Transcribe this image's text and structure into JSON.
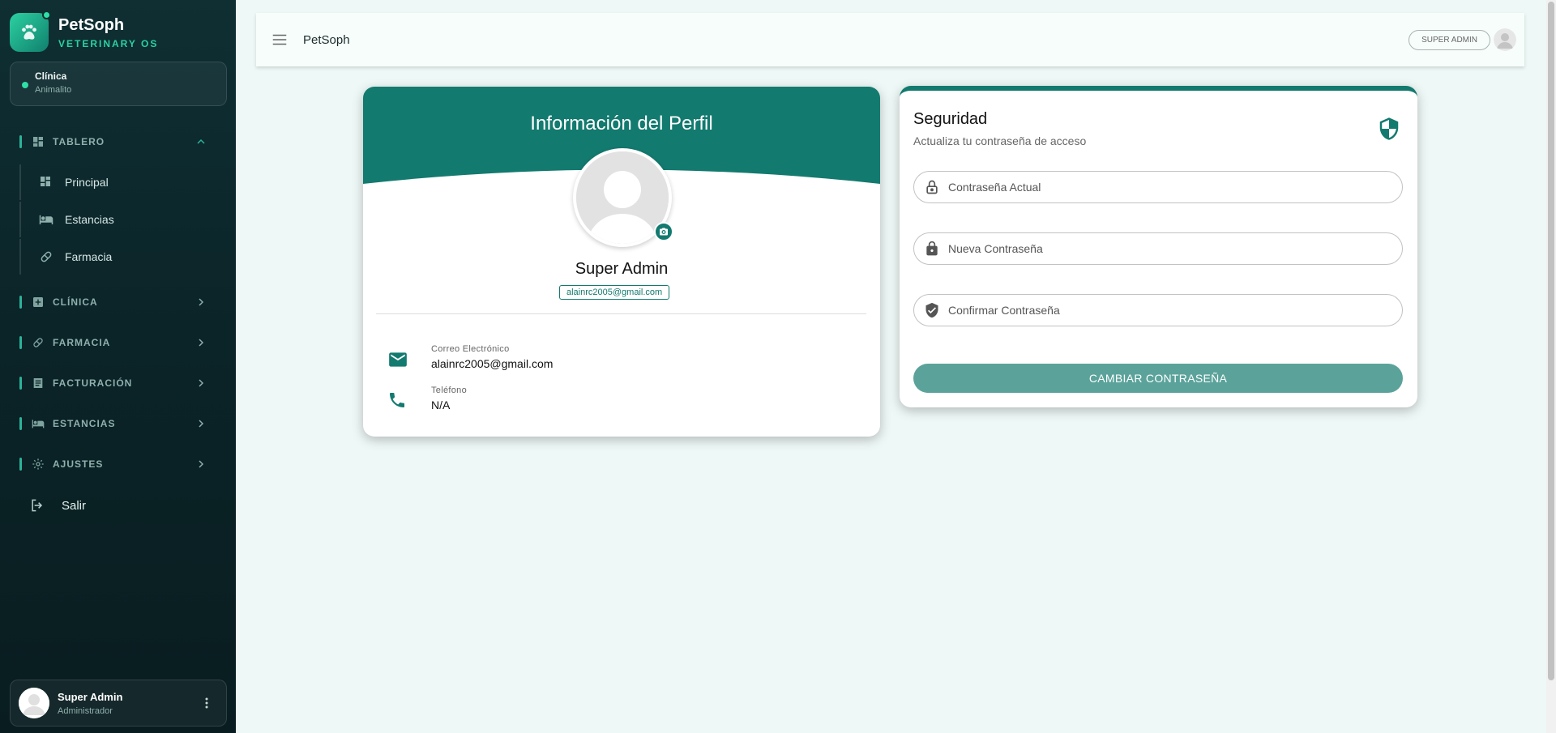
{
  "sidebar": {
    "brand_name": "PetSoph",
    "brand_sub": "VETERINARY OS",
    "clinic_label": "Clínica",
    "clinic_name": "Animalito",
    "sections": [
      {
        "label": "TABLERO",
        "icon": "dashboard-icon",
        "expanded": true
      },
      {
        "label": "CLÍNICA",
        "icon": "medical-plus-icon",
        "expanded": false
      },
      {
        "label": "FARMACIA",
        "icon": "pill-icon",
        "expanded": false
      },
      {
        "label": "FACTURACIÓN",
        "icon": "receipt-icon",
        "expanded": false
      },
      {
        "label": "ESTANCIAS",
        "icon": "bed-icon",
        "expanded": false
      },
      {
        "label": "AJUSTES",
        "icon": "gear-icon",
        "expanded": false
      }
    ],
    "tablero_items": [
      {
        "label": "Principal",
        "icon": "dashboard-icon"
      },
      {
        "label": "Estancias",
        "icon": "bed-icon"
      },
      {
        "label": "Farmacia",
        "icon": "pill-icon"
      }
    ],
    "logout_label": "Salir",
    "user_name": "Super Admin",
    "user_role": "Administrador"
  },
  "topbar": {
    "title": "PetSoph",
    "role_chip": "SUPER ADMIN"
  },
  "profile": {
    "title": "Información del Perfil",
    "name": "Super Admin",
    "email_chip": "alainrc2005@gmail.com",
    "email_label": "Correo Electrónico",
    "email_value": "alainrc2005@gmail.com",
    "phone_label": "Teléfono",
    "phone_value": "N/A"
  },
  "security": {
    "title": "Seguridad",
    "subtitle": "Actualiza tu contraseña de acceso",
    "current_placeholder": "Contraseña Actual",
    "new_placeholder": "Nueva Contraseña",
    "confirm_placeholder": "Confirmar Contraseña",
    "button_label": "CAMBIAR CONTRASEÑA"
  },
  "colors": {
    "primary": "#137a6f",
    "sidebar_bg": "#0b2428",
    "accent": "#2bd1a1",
    "button": "#5ba39a",
    "page_bg": "#eef8f6"
  }
}
